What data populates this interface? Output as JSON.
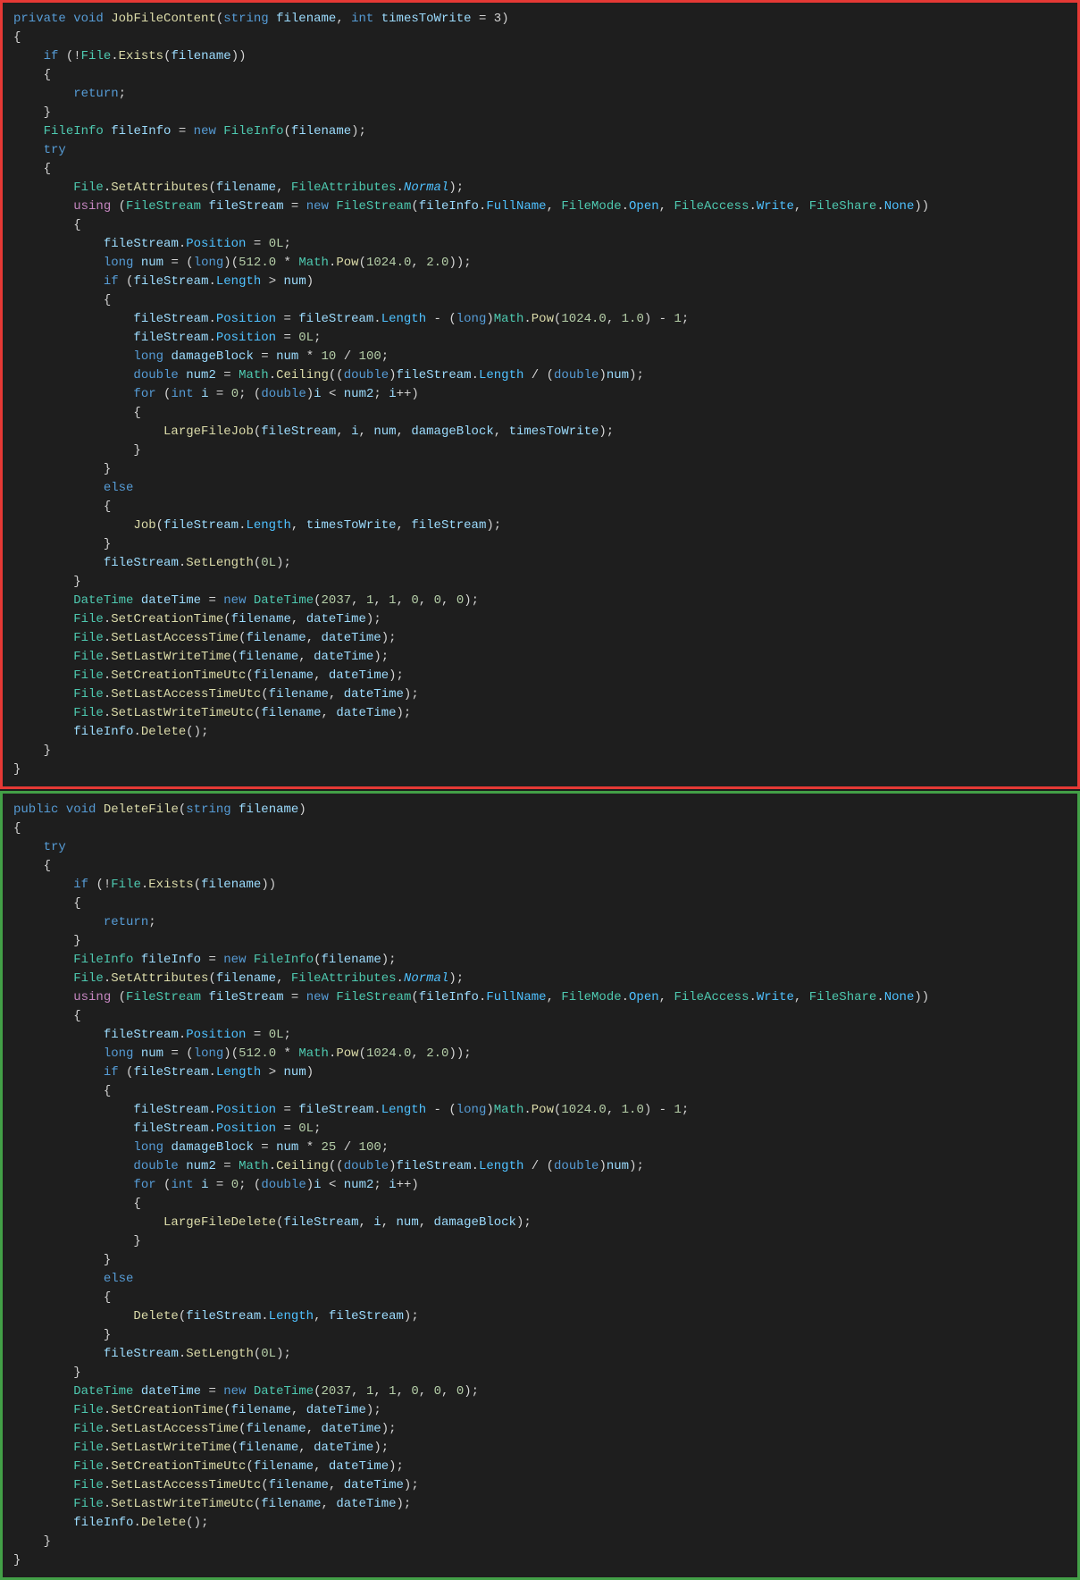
{
  "sections": [
    {
      "id": "red",
      "border": "red",
      "lines": [
        {
          "id": "r1"
        },
        {
          "id": "r2"
        },
        {
          "id": "r3"
        },
        {
          "id": "r4"
        },
        {
          "id": "r5"
        },
        {
          "id": "r6"
        },
        {
          "id": "r7"
        },
        {
          "id": "r8"
        },
        {
          "id": "r9"
        },
        {
          "id": "r10"
        }
      ]
    },
    {
      "id": "green",
      "border": "green",
      "lines": []
    }
  ]
}
